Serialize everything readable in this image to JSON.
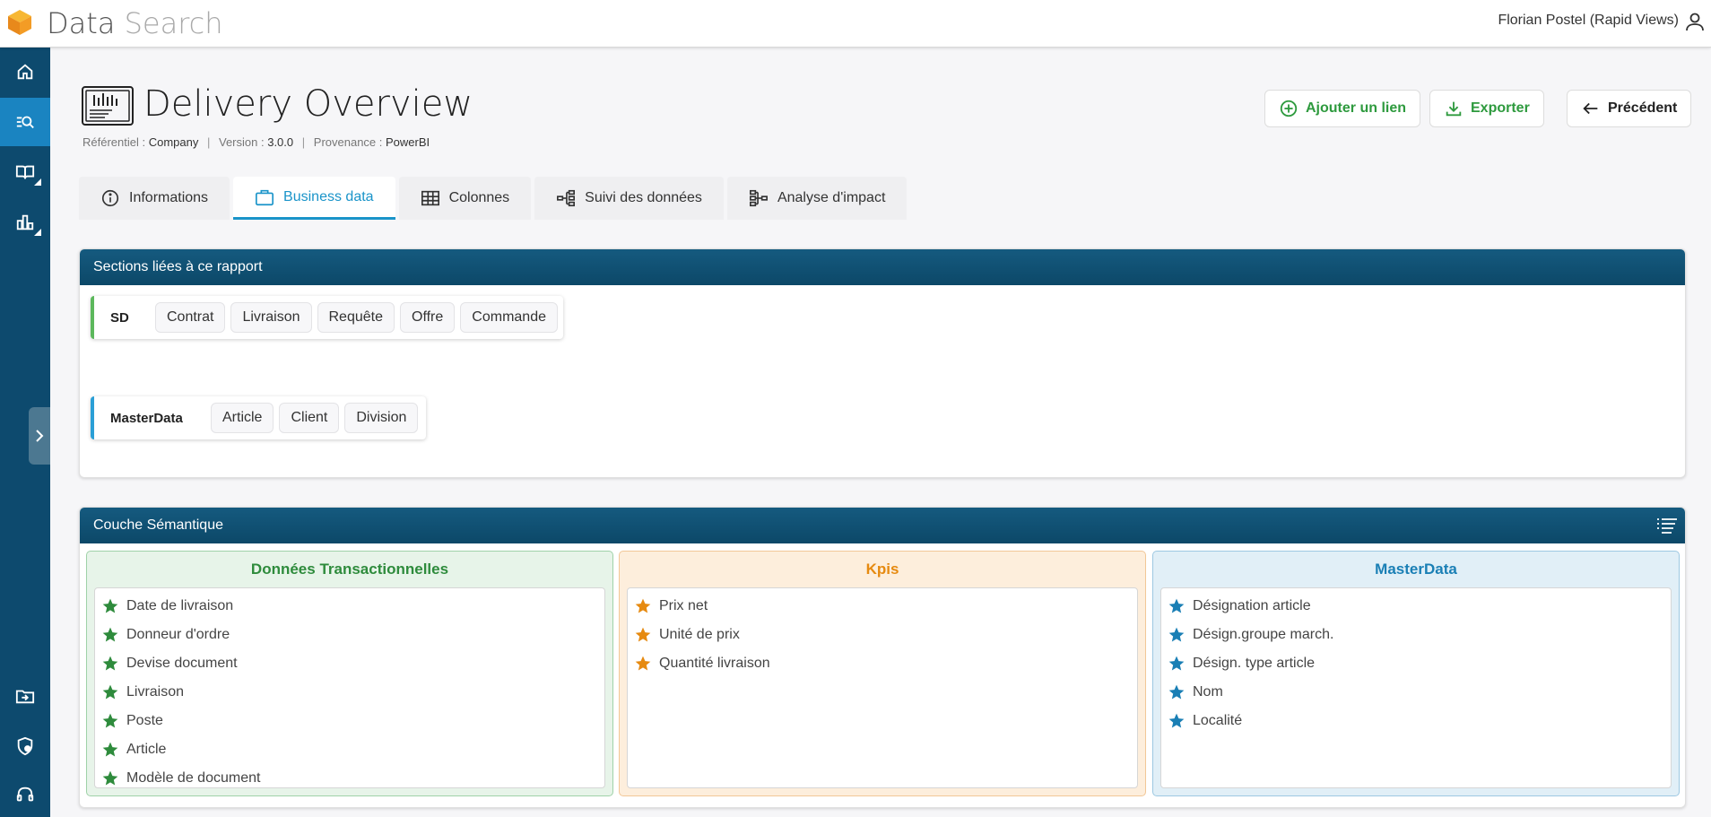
{
  "app": {
    "title_part1": "Data",
    "title_part2": "Search"
  },
  "user": {
    "name": "Florian Postel (Rapid Views)"
  },
  "report": {
    "title": "Delivery Overview",
    "meta": {
      "referentiel_label": "Référentiel :",
      "referentiel_value": "Company",
      "version_label": "Version :",
      "version_value": "3.0.0",
      "provenance_label": "Provenance :",
      "provenance_value": "PowerBI",
      "separator": "|"
    }
  },
  "actions": {
    "add_link": "Ajouter un lien",
    "export": "Exporter",
    "previous": "Précédent"
  },
  "tabs": [
    {
      "label": "Informations"
    },
    {
      "label": "Business data"
    },
    {
      "label": "Colonnes"
    },
    {
      "label": "Suivi des données"
    },
    {
      "label": "Analyse d'impact"
    }
  ],
  "sections_panel": {
    "title": "Sections liées à ce rapport",
    "groups": [
      {
        "name": "SD",
        "chips": [
          "Contrat",
          "Livraison",
          "Requête",
          "Offre",
          "Commande"
        ]
      },
      {
        "name": "MasterData",
        "chips": [
          "Article",
          "Client",
          "Division"
        ]
      }
    ]
  },
  "semantic_panel": {
    "title": "Couche Sémantique",
    "columns": [
      {
        "title": "Données Transactionnelles",
        "color": "#2e8b3c",
        "items": [
          "Date de livraison",
          "Donneur d'ordre",
          "Devise document",
          "Livraison",
          "Poste",
          "Article",
          "Modèle de document"
        ]
      },
      {
        "title": "Kpis",
        "color": "#e68a10",
        "items": [
          "Prix net",
          "Unité de prix",
          "Quantité livraison"
        ]
      },
      {
        "title": "MasterData",
        "color": "#1a7fb5",
        "items": [
          "Désignation article",
          "Désign.groupe march.",
          "Désign. type article",
          "Nom",
          "Localité"
        ]
      }
    ]
  },
  "colors": {
    "sidebar": "#0d4a6e",
    "accent": "#1a94c9",
    "green": "#2e9a3e"
  }
}
